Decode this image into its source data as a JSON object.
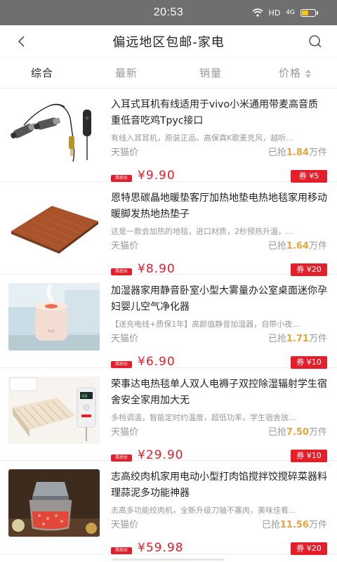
{
  "status_bar": {
    "time": "20:53",
    "network": "HD",
    "signal": "4G"
  },
  "nav": {
    "title": "偏远地区包邮-家电"
  },
  "tabs": [
    {
      "label": "综合",
      "active": true
    },
    {
      "label": "最新",
      "active": false
    },
    {
      "label": "销量",
      "active": false
    },
    {
      "label": "价格",
      "active": false
    }
  ],
  "products": [
    {
      "title": "入耳式耳机有线适用于vivo小米通用带麦高音质重低音吃鸡Tpyc接口",
      "desc": "有线入耳耳机，原装正品。高保真K歌麦克风，越听...",
      "store_label": "天猫价",
      "sold_prefix": "已抢",
      "sold_value": "1.84",
      "sold_unit": "万件",
      "tag": "券后价",
      "price": "¥9.90",
      "coupon": "券 ¥5"
    },
    {
      "title": "恩特思碳晶地暖垫客厅加热地垫电热地毯家用移动暖脚发热地热垫子",
      "desc": "这是一款会加热的地毯，进口材质，2秒预热升温，...",
      "store_label": "天猫价",
      "sold_prefix": "已抢",
      "sold_value": "1.64",
      "sold_unit": "万件",
      "tag": "券后价",
      "price": "¥8.90",
      "coupon": "券 ¥20"
    },
    {
      "title": "加湿器家用静音卧室小型大雾量办公室桌面迷你孕妇婴儿空气净化器",
      "desc": "【送充电线+质保1年】高颜值静音加湿器，自带小夜...",
      "store_label": "天猫价",
      "sold_prefix": "已抢",
      "sold_value": "1.71",
      "sold_unit": "万件",
      "tag": "券后价",
      "price": "¥6.90",
      "coupon": "券 ¥10"
    },
    {
      "title": "荣事达电热毯单人双人电褥子双控除湿辐射学生宿舍安全家用加大无",
      "desc": "多档调温，智能定时约温度，超低功率，学生宿舍放...",
      "store_label": "天猫价",
      "sold_prefix": "已抢",
      "sold_value": "7.50",
      "sold_unit": "万件",
      "tag": "券后价",
      "price": "¥29.90",
      "coupon": "券 ¥10"
    },
    {
      "title": "志高绞肉机家用电动小型打肉馅搅拌饺搅碎菜器料理蒜泥多功能神器",
      "desc": "志高多功能绞肉机，全新升级刀轴不塞肉，美味佳肴...",
      "store_label": "天猫价",
      "sold_prefix": "已抢",
      "sold_value": "11.56",
      "sold_unit": "万件",
      "tag": "券后价",
      "price": "¥59.98",
      "coupon": "券 ¥20"
    }
  ],
  "product_images": [
    "earphones-image",
    "heating-mat-image",
    "humidifier-image",
    "electric-blanket-image",
    "meat-grinder-image"
  ],
  "colors": {
    "accent": "#e41f2b",
    "sold_highlight": "#e8a33c",
    "status_bar": "#6f6f6f"
  },
  "battery_level": 0.55
}
